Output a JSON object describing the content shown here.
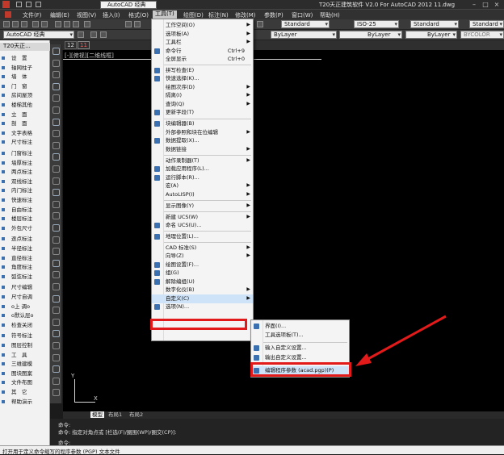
{
  "window": {
    "title": "T20天正建筑软件 V2.0 For AutoCAD 2012    11.dwg",
    "workspace": "AutoCAD 经典"
  },
  "menubar": [
    "文件(F)",
    "编辑(E)",
    "视图(V)",
    "插入(I)",
    "格式(O)",
    "工具(T)",
    "绘图(D)",
    "标注(N)",
    "修改(M)",
    "参数(P)",
    "窗口(W)",
    "帮助(H)"
  ],
  "toolbar": {
    "workspace_combo": "AutoCAD 经典",
    "text_style": "Standard",
    "dim_style": "ISO-25",
    "table_style": "Standard",
    "multileader_style": "Standard",
    "layer_color": "ByLayer",
    "linetype": "ByLayer",
    "lineweight": "ByLayer",
    "plotstyle": "BYCOLOR"
  },
  "tabs": {
    "first": "12",
    "second": "11"
  },
  "leftpanel": {
    "header": "T20天正...",
    "items": [
      "设　置",
      "轴网柱子",
      "墙　体",
      "门　窗",
      "房间屋顶",
      "楼梯其他",
      "立　面",
      "剖　面",
      "文字表格",
      "尺寸标注",
      "门窗标注",
      "墙厚标注",
      "两点标注",
      "双线标注",
      "内门标注",
      "快速标注",
      "自由标注",
      "楼层标注",
      "外包尺寸",
      "逐点标注",
      "半径标注",
      "直径标注",
      "角度标注",
      "弧弦标注",
      "尺寸编辑",
      "尺寸自调",
      "o上 调o",
      "o默认层o",
      "检查关闭",
      "符号标注",
      "图层控制",
      "工　具",
      "三维建模",
      "图块图案",
      "文件布图",
      "其　它",
      "帮助演示"
    ]
  },
  "canvas": {
    "view_label": "[-][俯视][二维线框]"
  },
  "model_tabs": [
    "模型",
    "布局1",
    "布局2"
  ],
  "command": {
    "line1": "命令:",
    "line2": "命令: 指定对角点或 [栏选(F)/圈围(WP)/圈交(CP)]:",
    "line3": "命令:"
  },
  "status": "打开用于定义命令缩写的程序参数 (PGP) 文本文件",
  "tools_menu": [
    {
      "label": "工作空间(O)",
      "arrow": true
    },
    {
      "label": "选项板(A)",
      "arrow": true
    },
    {
      "label": "工具栏",
      "arrow": true
    },
    {
      "label": "命令行",
      "shortcut": "Ctrl+9",
      "icon": true
    },
    {
      "label": "全屏显示",
      "shortcut": "Ctrl+0"
    },
    {
      "sep": true
    },
    {
      "label": "拼写检查(E)",
      "icon": true
    },
    {
      "label": "快速选择(K)...",
      "icon": true
    },
    {
      "label": "绘图次序(D)",
      "arrow": true
    },
    {
      "label": "隔离(I)",
      "arrow": true
    },
    {
      "label": "查询(Q)",
      "arrow": true
    },
    {
      "label": "更新字段(T)",
      "icon": true
    },
    {
      "sep": true
    },
    {
      "label": "块编辑器(B)",
      "icon": true
    },
    {
      "label": "外部参照和块在位编辑",
      "arrow": true
    },
    {
      "label": "数据提取(X)...",
      "icon": true
    },
    {
      "label": "数据链接",
      "arrow": true
    },
    {
      "sep": true
    },
    {
      "label": "动作录制器(T)",
      "arrow": true
    },
    {
      "label": "加载应用程序(L)...",
      "icon": true
    },
    {
      "label": "运行脚本(R)...",
      "icon": true
    },
    {
      "label": "宏(A)",
      "arrow": true
    },
    {
      "label": "AutoLISP(I)",
      "arrow": true
    },
    {
      "sep": true
    },
    {
      "label": "显示图像(Y)",
      "arrow": true
    },
    {
      "sep": true
    },
    {
      "label": "新建 UCS(W)",
      "arrow": true
    },
    {
      "label": "命名 UCS(U)...",
      "icon": true
    },
    {
      "sep": true
    },
    {
      "label": "地理位置(L)...",
      "icon": true
    },
    {
      "sep": true
    },
    {
      "label": "CAD 标准(S)",
      "arrow": true
    },
    {
      "label": "向导(Z)",
      "arrow": true
    },
    {
      "label": "绘图设置(F)...",
      "icon": true
    },
    {
      "label": "组(G)",
      "icon": true
    },
    {
      "label": "解除编组(U)",
      "icon": true
    },
    {
      "label": "数字化仪(B)",
      "arrow": true
    },
    {
      "label": "自定义(C)",
      "arrow": true,
      "highlight": true
    },
    {
      "label": "选项(N)...",
      "icon": true
    }
  ],
  "customize_submenu": [
    {
      "label": "界面(I)...",
      "icon": true
    },
    {
      "label": "工具选项板(T)..."
    },
    {
      "sep": true
    },
    {
      "label": "输入自定义设置...",
      "icon": true
    },
    {
      "label": "输出自定义设置...",
      "icon": true
    },
    {
      "sep": true
    },
    {
      "label": "编辑程序参数 (acad.pgp)(P)",
      "icon": true,
      "highlight": true
    }
  ],
  "colors": {
    "annotation_red": "#e21a1a",
    "menu_bg": "#f4f4f4",
    "canvas_bg": "#000000",
    "icon_blue": "#3a6fb0"
  }
}
